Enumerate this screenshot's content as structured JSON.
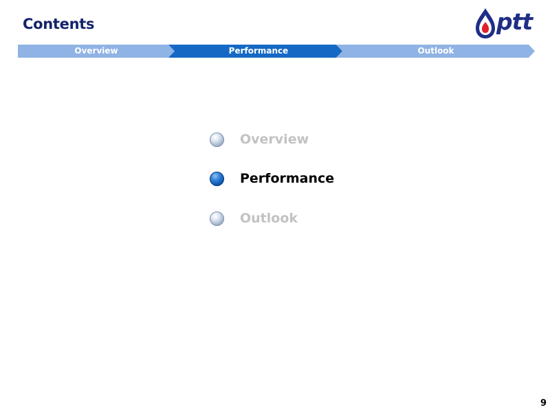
{
  "header": {
    "title": "Contents",
    "logo_text": "ptt"
  },
  "progress_tabs": [
    {
      "label": "Overview",
      "state": "inactive"
    },
    {
      "label": "Performance",
      "state": "active"
    },
    {
      "label": "Outlook",
      "state": "inactive"
    }
  ],
  "agenda": {
    "items": [
      {
        "label": "Overview",
        "state": "inactive"
      },
      {
        "label": "Performance",
        "state": "active"
      },
      {
        "label": "Outlook",
        "state": "inactive"
      }
    ]
  },
  "footer": {
    "page_number": "9"
  },
  "colors": {
    "title": "#14246b",
    "tab_inactive": "#8fb3e4",
    "tab_active": "#1569c4",
    "agenda_inactive_text": "#c2c2c2",
    "agenda_active_text": "#000000",
    "logo_blue": "#1f2f86",
    "logo_red": "#e0202a"
  }
}
